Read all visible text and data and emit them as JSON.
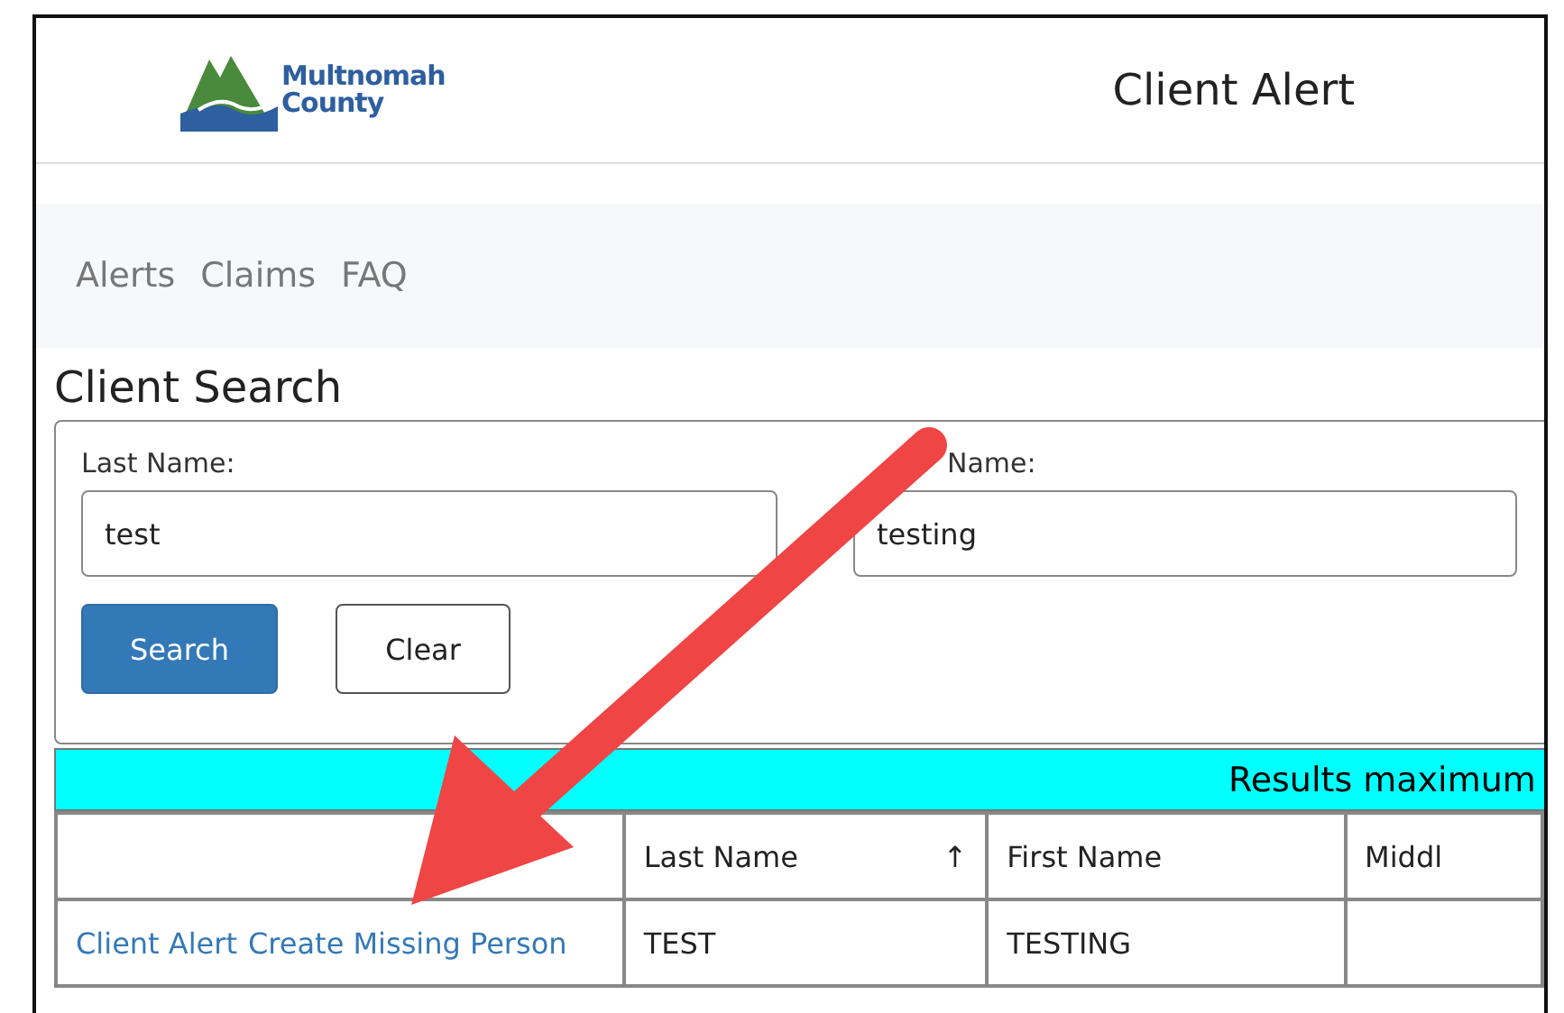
{
  "header": {
    "logo_text": [
      "Multnomah",
      "County"
    ],
    "title": "Client Alert"
  },
  "nav": [
    {
      "label": "Alerts"
    },
    {
      "label": "Claims"
    },
    {
      "label": "FAQ"
    }
  ],
  "search": {
    "heading": "Client Search",
    "fields": [
      {
        "label": "Last Name:",
        "value": "test"
      },
      {
        "label": "Name:",
        "value": "testing"
      }
    ],
    "buttons": [
      {
        "label": "Search",
        "kind": "primary"
      },
      {
        "label": "Clear",
        "kind": "default"
      }
    ]
  },
  "results_banner": "Results maximum",
  "table": {
    "columns": [
      {},
      {
        "label": "Last Name",
        "sort": "↑"
      },
      {
        "label": "First Name"
      },
      {
        "label": "Middl"
      }
    ],
    "rows": [
      {
        "cells": [
          {
            "links": [
              "Client Alert",
              "Create Missing Person"
            ]
          },
          {
            "text": "TEST"
          },
          {
            "text": "TESTING"
          },
          {}
        ]
      }
    ]
  }
}
